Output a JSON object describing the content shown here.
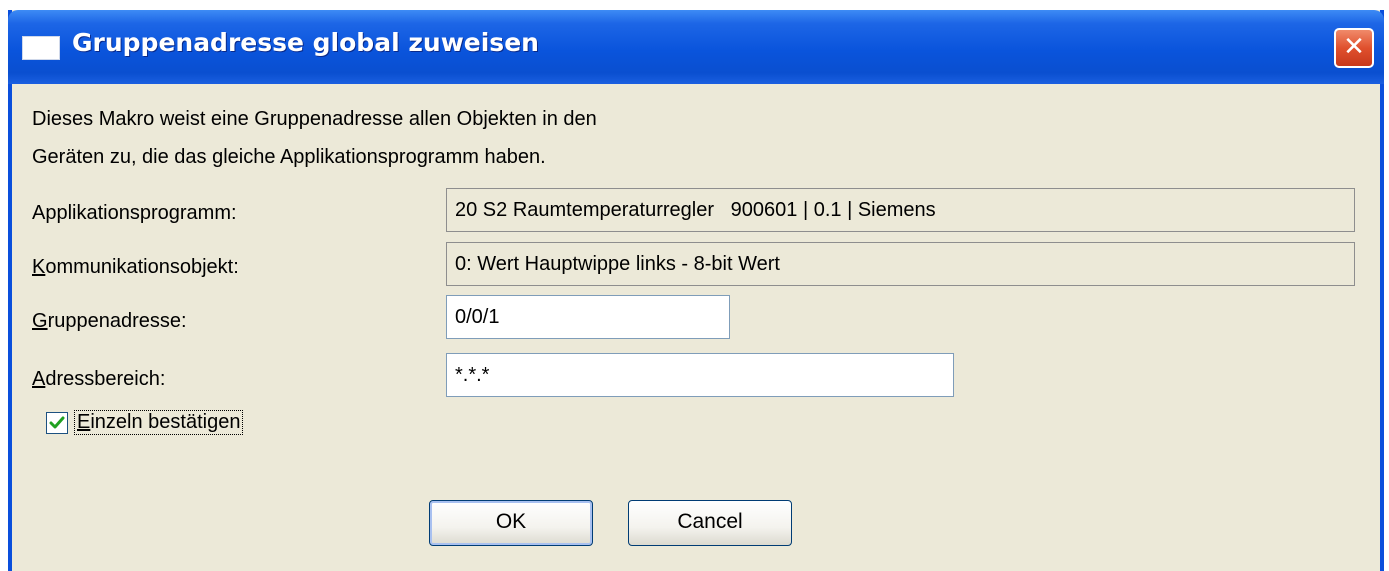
{
  "window": {
    "title": "Gruppenadresse global zuweisen",
    "close_glyph": "✕"
  },
  "description": {
    "line1": "Dieses Makro weist eine Gruppenadresse allen Objekten in den",
    "line2": "Geräten zu, die das gleiche Applikationsprogramm haben."
  },
  "fields": {
    "application": {
      "label": "Applikationsprogramm:",
      "value": "20 S2 Raumtemperaturregler   900601 | 0.1 | Siemens"
    },
    "comm_object": {
      "label_first": "K",
      "label_rest": "ommunikationsobjekt:",
      "value": "0: Wert Hauptwippe links - 8-bit Wert"
    },
    "group_address": {
      "label_first": "G",
      "label_rest": "ruppenadresse:",
      "value": "0/0/1"
    },
    "address_range": {
      "label_first": "A",
      "label_rest": "dressbereich:",
      "value": "*.*.*"
    }
  },
  "confirm_individually": {
    "label_first": "E",
    "label_rest": "inzeln bestätigen",
    "checked": true
  },
  "buttons": {
    "ok": "OK",
    "cancel": "Cancel"
  },
  "colors": {
    "title_bar": "#0a54dc",
    "dialog_bg": "#ece9d8",
    "close_button": "#e0502d",
    "checkmark": "#21a121"
  }
}
